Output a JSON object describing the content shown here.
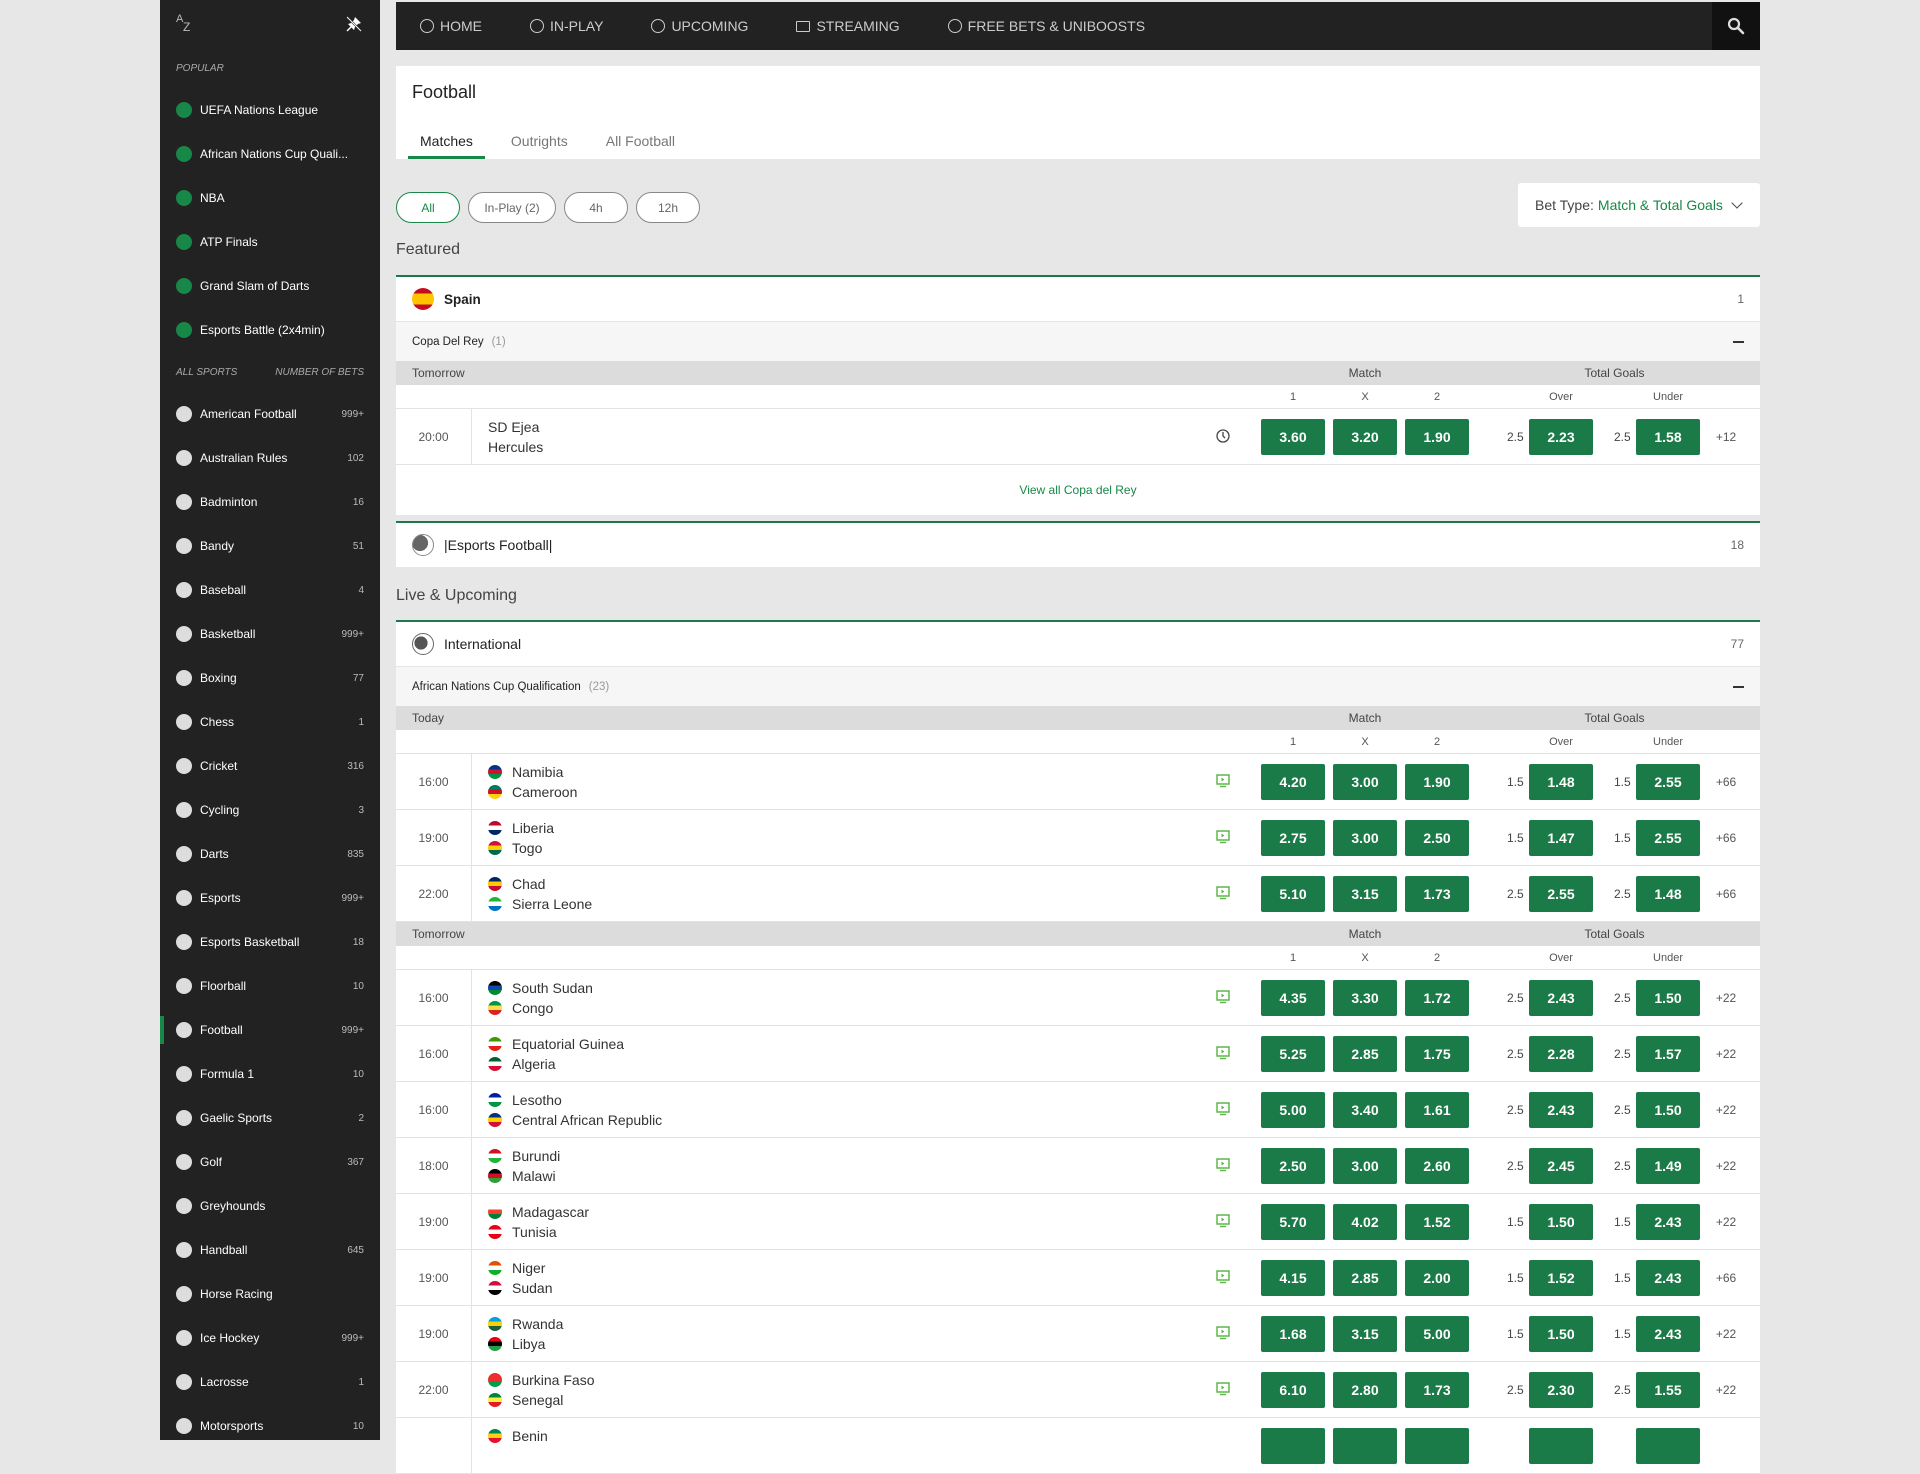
{
  "sidebar": {
    "popular_label": "POPULAR",
    "popular": [
      {
        "label": "UEFA Nations League",
        "icon": "football-icon"
      },
      {
        "label": "African Nations Cup Quali...",
        "icon": "football-icon"
      },
      {
        "label": "NBA",
        "icon": "basketball-icon"
      },
      {
        "label": "ATP Finals",
        "icon": "tennis-icon"
      },
      {
        "label": "Grand Slam of Darts",
        "icon": "darts-icon"
      },
      {
        "label": "Esports Battle (2x4min)",
        "icon": "football-icon"
      }
    ],
    "all_sports_label": "ALL SPORTS",
    "number_of_bets_label": "NUMBER OF BETS",
    "sports": [
      {
        "label": "American Football",
        "count": "999+",
        "icon": "american-football-icon"
      },
      {
        "label": "Australian Rules",
        "count": "102",
        "icon": "aussie-rules-icon"
      },
      {
        "label": "Badminton",
        "count": "16",
        "icon": "shuttlecock-icon"
      },
      {
        "label": "Bandy",
        "count": "51",
        "icon": "bandy-sticks-icon"
      },
      {
        "label": "Baseball",
        "count": "4",
        "icon": "baseball-icon"
      },
      {
        "label": "Basketball",
        "count": "999+",
        "icon": "basketball-icon"
      },
      {
        "label": "Boxing",
        "count": "77",
        "icon": "boxing-glove-icon"
      },
      {
        "label": "Chess",
        "count": "1",
        "icon": "chess-knight-icon"
      },
      {
        "label": "Cricket",
        "count": "316",
        "icon": "cricket-ball-icon"
      },
      {
        "label": "Cycling",
        "count": "3",
        "icon": "cycling-helmet-icon"
      },
      {
        "label": "Darts",
        "count": "835",
        "icon": "dartboard-icon"
      },
      {
        "label": "Esports",
        "count": "999+",
        "icon": "gamepad-icon"
      },
      {
        "label": "Esports Basketball",
        "count": "18",
        "icon": "globe-icon"
      },
      {
        "label": "Floorball",
        "count": "10",
        "icon": "floorball-icon"
      },
      {
        "label": "Football",
        "count": "999+",
        "icon": "football-icon",
        "active": true
      },
      {
        "label": "Formula 1",
        "count": "10",
        "icon": "helmet-icon"
      },
      {
        "label": "Gaelic Sports",
        "count": "2",
        "icon": "gaelic-ball-icon"
      },
      {
        "label": "Golf",
        "count": "367",
        "icon": "golf-ball-icon"
      },
      {
        "label": "Greyhounds",
        "count": "",
        "icon": "greyhound-icon"
      },
      {
        "label": "Handball",
        "count": "645",
        "icon": "handball-icon"
      },
      {
        "label": "Horse Racing",
        "count": "",
        "icon": "horse-racing-icon"
      },
      {
        "label": "Ice Hockey",
        "count": "999+",
        "icon": "puck-icon"
      },
      {
        "label": "Lacrosse",
        "count": "1",
        "icon": "globe-icon"
      },
      {
        "label": "Motorsports",
        "count": "10",
        "icon": "helmet-icon"
      }
    ]
  },
  "topnav": {
    "items": [
      {
        "label": "HOME",
        "icon": "home-globe-icon"
      },
      {
        "label": "IN-PLAY",
        "icon": "clock-icon"
      },
      {
        "label": "UPCOMING",
        "icon": "upcoming-icon"
      },
      {
        "label": "STREAMING",
        "icon": "screen-icon"
      },
      {
        "label": "FREE BETS & UNIBOOSTS",
        "icon": "boost-icon"
      }
    ]
  },
  "header": {
    "title": "Football",
    "tabs": [
      "Matches",
      "Outrights",
      "All Football"
    ],
    "active_tab": "Matches"
  },
  "filters": {
    "pills": [
      "All",
      "In-Play (2)",
      "4h",
      "12h"
    ],
    "active": "All",
    "bet_type_label": "Bet Type:",
    "bet_type_value": "Match & Total Goals"
  },
  "columns": {
    "match": "Match",
    "total_goals": "Total Goals",
    "one": "1",
    "x": "X",
    "two": "2",
    "over": "Over",
    "under": "Under"
  },
  "featured": {
    "title": "Featured",
    "spain": {
      "name": "Spain",
      "count": "1",
      "league": "Copa Del Rey",
      "league_count": "(1)",
      "day": "Tomorrow",
      "matches": [
        {
          "time": "20:00",
          "home": "SD Ejea",
          "away": "Hercules",
          "status": "clock",
          "odds": [
            "3.60",
            "3.20",
            "1.90"
          ],
          "over_line": "2.5",
          "over": "2.23",
          "under_line": "2.5",
          "under": "1.58",
          "more": "+12"
        }
      ],
      "view_all": "View all Copa del Rey"
    },
    "esports": {
      "name": "|Esports Football|",
      "count": "18"
    }
  },
  "live": {
    "title": "Live & Upcoming",
    "group": "International",
    "count": "77",
    "league": "African Nations Cup Qualification",
    "league_count": "(23)",
    "days": [
      {
        "label": "Today",
        "matches": [
          {
            "time": "16:00",
            "home": "Namibia",
            "away": "Cameroon",
            "odds": [
              "4.20",
              "3.00",
              "1.90"
            ],
            "over_line": "1.5",
            "over": "1.48",
            "under_line": "1.5",
            "under": "2.55",
            "more": "+66"
          },
          {
            "time": "19:00",
            "home": "Liberia",
            "away": "Togo",
            "odds": [
              "2.75",
              "3.00",
              "2.50"
            ],
            "over_line": "1.5",
            "over": "1.47",
            "under_line": "1.5",
            "under": "2.55",
            "more": "+66"
          },
          {
            "time": "22:00",
            "home": "Chad",
            "away": "Sierra Leone",
            "odds": [
              "5.10",
              "3.15",
              "1.73"
            ],
            "over_line": "2.5",
            "over": "2.55",
            "under_line": "2.5",
            "under": "1.48",
            "more": "+66"
          }
        ]
      },
      {
        "label": "Tomorrow",
        "matches": [
          {
            "time": "16:00",
            "home": "South Sudan",
            "away": "Congo",
            "odds": [
              "4.35",
              "3.30",
              "1.72"
            ],
            "over_line": "2.5",
            "over": "2.43",
            "under_line": "2.5",
            "under": "1.50",
            "more": "+22"
          },
          {
            "time": "16:00",
            "home": "Equatorial Guinea",
            "away": "Algeria",
            "odds": [
              "5.25",
              "2.85",
              "1.75"
            ],
            "over_line": "2.5",
            "over": "2.28",
            "under_line": "2.5",
            "under": "1.57",
            "more": "+22"
          },
          {
            "time": "16:00",
            "home": "Lesotho",
            "away": "Central African Republic",
            "odds": [
              "5.00",
              "3.40",
              "1.61"
            ],
            "over_line": "2.5",
            "over": "2.43",
            "under_line": "2.5",
            "under": "1.50",
            "more": "+22"
          },
          {
            "time": "18:00",
            "home": "Burundi",
            "away": "Malawi",
            "odds": [
              "2.50",
              "3.00",
              "2.60"
            ],
            "over_line": "2.5",
            "over": "2.45",
            "under_line": "2.5",
            "under": "1.49",
            "more": "+22"
          },
          {
            "time": "19:00",
            "home": "Madagascar",
            "away": "Tunisia",
            "odds": [
              "5.70",
              "4.02",
              "1.52"
            ],
            "over_line": "1.5",
            "over": "1.50",
            "under_line": "1.5",
            "under": "2.43",
            "more": "+22"
          },
          {
            "time": "19:00",
            "home": "Niger",
            "away": "Sudan",
            "odds": [
              "4.15",
              "2.85",
              "2.00"
            ],
            "over_line": "1.5",
            "over": "1.52",
            "under_line": "1.5",
            "under": "2.43",
            "more": "+66"
          },
          {
            "time": "19:00",
            "home": "Rwanda",
            "away": "Libya",
            "odds": [
              "1.68",
              "3.15",
              "5.00"
            ],
            "over_line": "1.5",
            "over": "1.50",
            "under_line": "1.5",
            "under": "2.43",
            "more": "+22"
          },
          {
            "time": "22:00",
            "home": "Burkina Faso",
            "away": "Senegal",
            "odds": [
              "6.10",
              "2.80",
              "1.73"
            ],
            "over_line": "2.5",
            "over": "2.30",
            "under_line": "2.5",
            "under": "1.55",
            "more": "+22"
          },
          {
            "time": "",
            "home": "Benin",
            "away": "",
            "odds": [
              "",
              "",
              ""
            ],
            "over_line": "",
            "over": "",
            "under_line": "",
            "under": "",
            "more": ""
          }
        ]
      }
    ]
  },
  "flags": {
    "Spain": [
      "#c60b1e",
      "#ffc400",
      "#c60b1e"
    ],
    "Namibia": [
      "#003580",
      "#d21034",
      "#009543"
    ],
    "Cameroon": [
      "#007a5e",
      "#ce1126",
      "#fcd116"
    ],
    "Liberia": [
      "#bf0a30",
      "#ffffff",
      "#002868"
    ],
    "Togo": [
      "#d21034",
      "#ffce00",
      "#006a4e"
    ],
    "Chad": [
      "#002664",
      "#fecb00",
      "#c60c30"
    ],
    "Sierra Leone": [
      "#1eb53a",
      "#ffffff",
      "#0072c6"
    ],
    "South Sudan": [
      "#000000",
      "#0f47af",
      "#078930"
    ],
    "Congo": [
      "#009543",
      "#fbde4a",
      "#dc241f"
    ],
    "Equatorial Guinea": [
      "#3e9a00",
      "#ffffff",
      "#e32118"
    ],
    "Algeria": [
      "#006233",
      "#ffffff",
      "#d21034"
    ],
    "Lesotho": [
      "#00209f",
      "#ffffff",
      "#009543"
    ],
    "Central African Republic": [
      "#003082",
      "#ffce00",
      "#d21034"
    ],
    "Burundi": [
      "#ce1126",
      "#ffffff",
      "#1eb53a"
    ],
    "Malawi": [
      "#000000",
      "#ce1126",
      "#339e35"
    ],
    "Madagascar": [
      "#ffffff",
      "#fc3d32",
      "#007e3a"
    ],
    "Tunisia": [
      "#e70013",
      "#ffffff",
      "#e70013"
    ],
    "Niger": [
      "#e05206",
      "#ffffff",
      "#0db02b"
    ],
    "Sudan": [
      "#d21034",
      "#ffffff",
      "#000000"
    ],
    "Rwanda": [
      "#00a1de",
      "#fad201",
      "#20603d"
    ],
    "Libya": [
      "#e70013",
      "#000000",
      "#239e46"
    ],
    "Burkina Faso": [
      "#ef2b2d",
      "#ef2b2d",
      "#009e49"
    ],
    "Senegal": [
      "#00853f",
      "#fdef42",
      "#e31b23"
    ],
    "Benin": [
      "#008751",
      "#fcd116",
      "#e8112d"
    ]
  },
  "colors": {
    "accent": "#178848",
    "odds_button": "#1a7a48",
    "sidebar_bg": "#222222",
    "page_bg": "#e7e7e7"
  }
}
